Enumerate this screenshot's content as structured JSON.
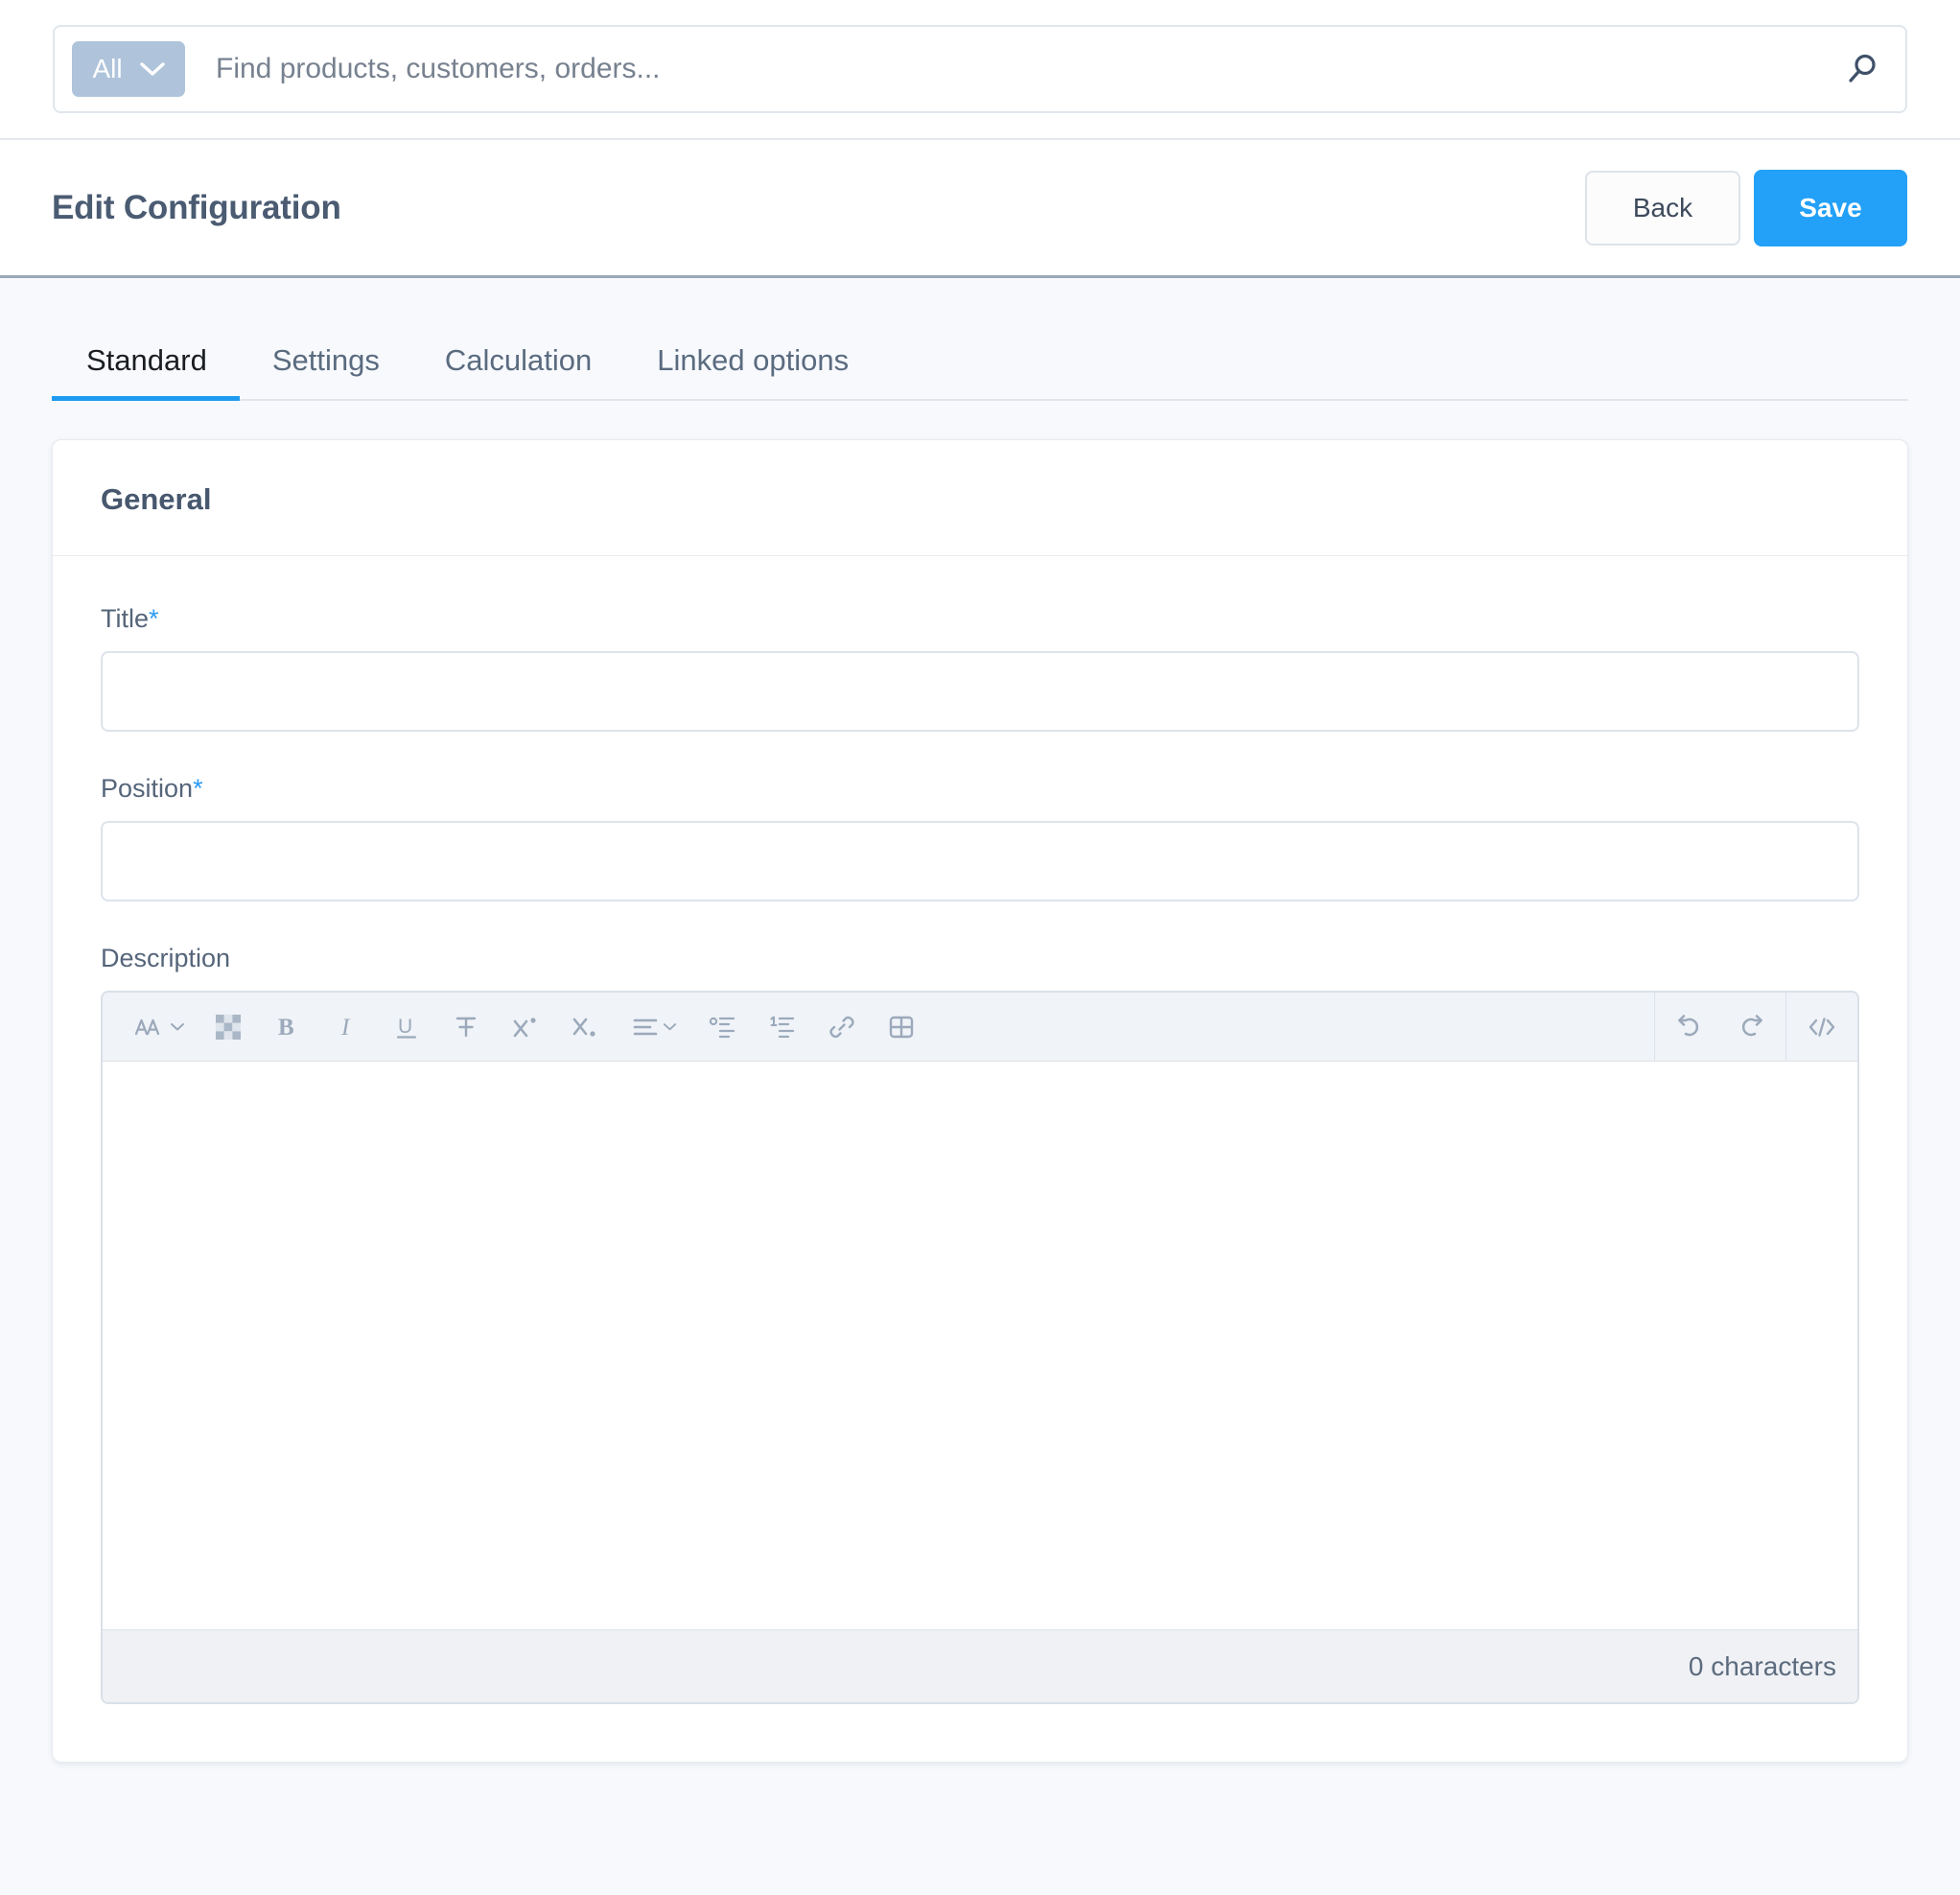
{
  "search": {
    "scope_label": "All",
    "scope_icon": "chevron-down-icon",
    "placeholder": "Find products, customers, orders...",
    "value": "",
    "submit_icon": "search-icon"
  },
  "header": {
    "title": "Edit Configuration",
    "back_label": "Back",
    "save_label": "Save",
    "save_color": "#23A0F7"
  },
  "tabs": [
    {
      "label": "Standard",
      "active": true
    },
    {
      "label": "Settings",
      "active": false
    },
    {
      "label": "Calculation",
      "active": false
    },
    {
      "label": "Linked options",
      "active": false
    }
  ],
  "card": {
    "title": "General",
    "fields": {
      "title": {
        "label": "Title",
        "required": true,
        "required_mark": "*",
        "value": "",
        "placeholder": ""
      },
      "position": {
        "label": "Position",
        "required": true,
        "required_mark": "*",
        "value": "",
        "placeholder": ""
      },
      "description": {
        "label": "Description",
        "value": "",
        "char_count": "0 characters"
      }
    }
  },
  "editor_toolbar": {
    "groups": [
      {
        "name": "format",
        "buttons": [
          {
            "icon": "font-size-icon",
            "label": "Font size"
          },
          {
            "icon": "text-color-icon",
            "label": "Text color"
          },
          {
            "icon": "bold-icon",
            "label": "Bold"
          },
          {
            "icon": "italic-icon",
            "label": "Italic"
          },
          {
            "icon": "underline-icon",
            "label": "Underline"
          },
          {
            "icon": "strikethrough-icon",
            "label": "Strikethrough"
          },
          {
            "icon": "superscript-icon",
            "label": "Superscript"
          },
          {
            "icon": "subscript-icon",
            "label": "Subscript"
          },
          {
            "icon": "align-icon",
            "label": "Align"
          },
          {
            "icon": "bullet-list-icon",
            "label": "Bullet list"
          },
          {
            "icon": "numbered-list-icon",
            "label": "Numbered list"
          },
          {
            "icon": "link-icon",
            "label": "Insert link"
          },
          {
            "icon": "table-icon",
            "label": "Insert table"
          }
        ]
      },
      {
        "name": "history",
        "buttons": [
          {
            "icon": "undo-icon",
            "label": "Undo"
          },
          {
            "icon": "redo-icon",
            "label": "Redo"
          }
        ]
      },
      {
        "name": "source",
        "buttons": [
          {
            "icon": "code-view-icon",
            "label": "Source code"
          }
        ]
      }
    ]
  },
  "colors": {
    "page_background": "#F7F9FC",
    "accent": "#1E9BF0",
    "title_text": "#4A5B72",
    "scope_button": "#AFC4DA"
  }
}
